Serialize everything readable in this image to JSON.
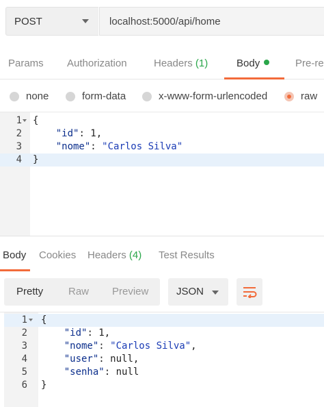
{
  "request": {
    "method": "POST",
    "url": "localhost:5000/api/home"
  },
  "request_tabs": {
    "params": "Params",
    "authorization": "Authorization",
    "headers": "Headers",
    "headers_count": "(1)",
    "body": "Body",
    "prerequest": "Pre-re"
  },
  "body_types": {
    "none": "none",
    "form_data": "form-data",
    "urlencoded": "x-www-form-urlencoded",
    "raw": "raw",
    "selected": "raw"
  },
  "request_body": {
    "lines": [
      {
        "n": "1",
        "text": "{"
      },
      {
        "n": "2",
        "indent": "    ",
        "key": "\"id\"",
        "sep": ": ",
        "value": "1",
        "tail": ","
      },
      {
        "n": "3",
        "indent": "    ",
        "key": "\"nome\"",
        "sep": ": ",
        "value": "\"Carlos Silva\"",
        "tail": ""
      },
      {
        "n": "4",
        "text": "}"
      }
    ]
  },
  "response_tabs": {
    "body": "Body",
    "cookies": "Cookies",
    "headers": "Headers",
    "headers_count": "(4)",
    "test_results": "Test Results"
  },
  "response_toolbar": {
    "pretty": "Pretty",
    "raw": "Raw",
    "preview": "Preview",
    "format": "JSON",
    "wrap_icon": "wrap-lines-icon"
  },
  "response_body": {
    "lines": [
      {
        "n": "1",
        "text": "{"
      },
      {
        "n": "2",
        "indent": "    ",
        "key": "\"id\"",
        "sep": ": ",
        "value": "1",
        "tail": ","
      },
      {
        "n": "3",
        "indent": "    ",
        "key": "\"nome\"",
        "sep": ": ",
        "value": "\"Carlos Silva\"",
        "tail": ","
      },
      {
        "n": "4",
        "indent": "    ",
        "key": "\"user\"",
        "sep": ": ",
        "value": "null",
        "tail": ","
      },
      {
        "n": "5",
        "indent": "    ",
        "key": "\"senha\"",
        "sep": ": ",
        "value": "null",
        "tail": ""
      },
      {
        "n": "6",
        "text": "}"
      }
    ]
  },
  "colors": {
    "accent": "#f26b3a",
    "count_green": "#2aa64a",
    "json_key": "#0b2e8c",
    "line_highlight": "#e7f1fb"
  }
}
